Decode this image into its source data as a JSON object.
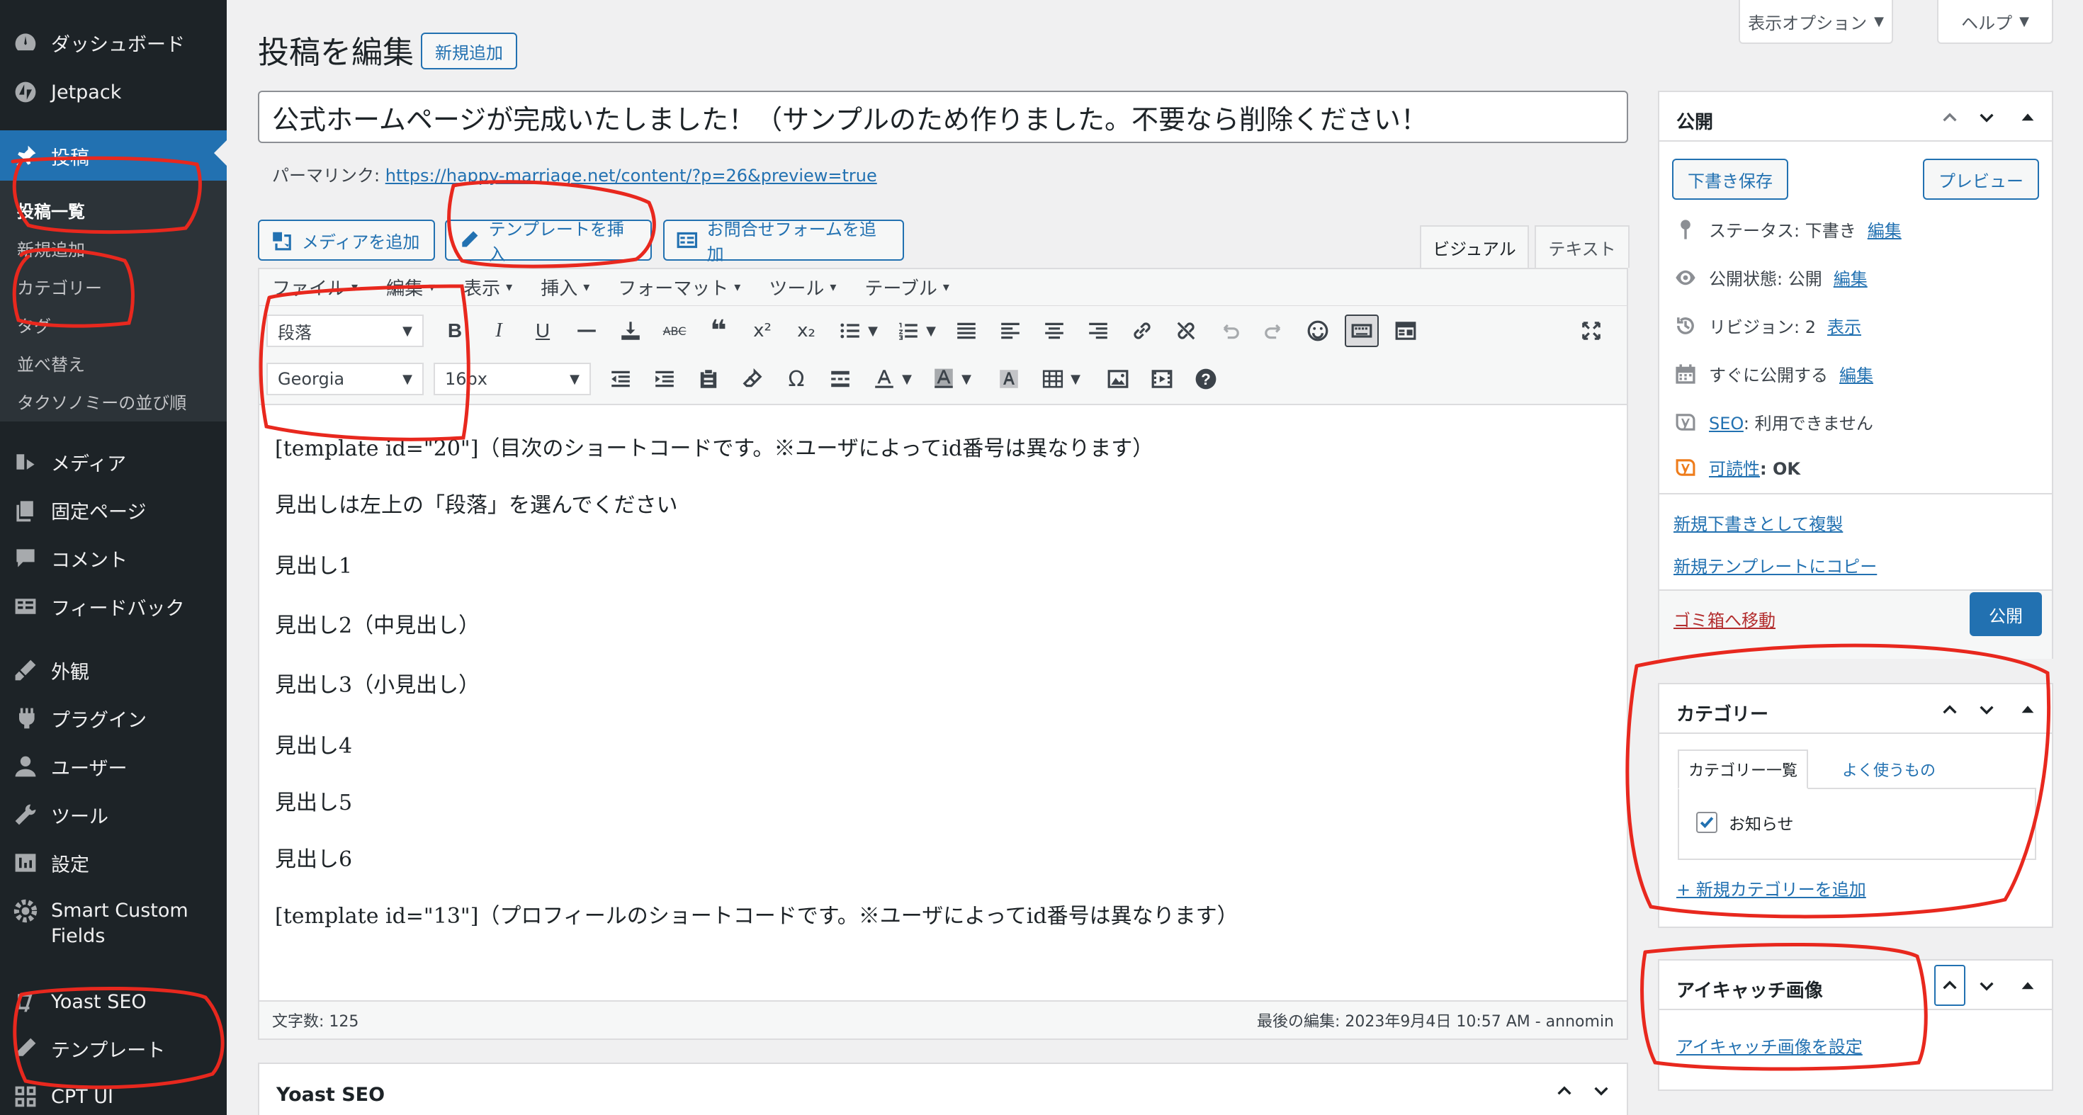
{
  "sidebar": {
    "items": [
      {
        "label": "ダッシュボード",
        "icon": "dashboard-icon"
      },
      {
        "label": "Jetpack",
        "icon": "jetpack-icon"
      },
      {
        "label": "投稿",
        "icon": "pin-icon"
      },
      {
        "label": "メディア",
        "icon": "media-icon"
      },
      {
        "label": "固定ページ",
        "icon": "page-icon"
      },
      {
        "label": "コメント",
        "icon": "comment-icon"
      },
      {
        "label": "フィードバック",
        "icon": "feedback-icon"
      },
      {
        "label": "外観",
        "icon": "appearance-icon"
      },
      {
        "label": "プラグイン",
        "icon": "plugin-icon"
      },
      {
        "label": "ユーザー",
        "icon": "user-icon"
      },
      {
        "label": "ツール",
        "icon": "tool-icon"
      },
      {
        "label": "設定",
        "icon": "settings-icon"
      },
      {
        "label": "Smart Custom Fields",
        "icon": "gear-icon"
      },
      {
        "label": "Yoast SEO",
        "icon": "yoast-icon"
      },
      {
        "label": "テンプレート",
        "icon": "pencil-icon"
      },
      {
        "label": "CPT UI",
        "icon": "cpt-icon"
      }
    ],
    "subitems": [
      "投稿一覧",
      "新規追加",
      "カテゴリー",
      "タグ",
      "並べ替え",
      "タクソノミーの並び順"
    ]
  },
  "screen_options": {
    "label": "表示オプション",
    "help": "ヘルプ"
  },
  "page": {
    "title": "投稿を編集",
    "add_new": "新規追加"
  },
  "post": {
    "title": "公式ホームページが完成いたしました！（サンプルのため作りました。不要なら削除ください！",
    "permalink_label": "パーマリンク:",
    "permalink_url": "https://happy-marriage.net/content/?p=26&preview=true"
  },
  "media_buttons": {
    "add_media": "メディアを追加",
    "insert_template": "テンプレートを挿入",
    "add_form": "お問合せフォームを追加"
  },
  "editor": {
    "tab_visual": "ビジュアル",
    "tab_text": "テキスト",
    "menus": [
      "ファイル",
      "編集",
      "表示",
      "挿入",
      "フォーマット",
      "ツール",
      "テーブル"
    ],
    "format_select": "段落",
    "font_select": "Georgia",
    "size_select": "16px",
    "paragraphs": [
      "[template id=\"20\"]（目次のショートコードです。※ユーザによってid番号は異なります）",
      "見出しは左上の「段落」を選んでください",
      "見出し1",
      "見出し2（中見出し）",
      "見出し3（小見出し）",
      "見出し4",
      "見出し5",
      "見出し6",
      "[template id=\"13\"]（プロフィールのショートコードです。※ユーザによってid番号は異なります）"
    ],
    "word_count": "文字数: 125",
    "last_edit": "最後の編集: 2023年9月4日 10:57 AM - annomin"
  },
  "yoast_box": {
    "title": "Yoast SEO"
  },
  "publish_box": {
    "title": "公開",
    "save_draft": "下書き保存",
    "preview": "プレビュー",
    "status_label": "ステータス: 下書き",
    "visibility_label": "公開状態: 公開",
    "revisions_label": "リビジョン: 2",
    "schedule_label": "すぐに公開する",
    "edit": "編集",
    "show": "表示",
    "seo_link": "SEO",
    "seo_text": ": 利用できません",
    "readability_link": "可読性",
    "readability_text": ": OK",
    "duplicate_draft": "新規下書きとして複製",
    "copy_template": "新規テンプレートにコピー",
    "trash": "ゴミ箱へ移動",
    "publish": "公開"
  },
  "category_box": {
    "title": "カテゴリー",
    "tab_all": "カテゴリー一覧",
    "tab_popular": "よく使うもの",
    "categories": [
      {
        "label": "お知らせ",
        "checked": true
      }
    ],
    "add_new": "+ 新規カテゴリーを追加"
  },
  "thumbnail_box": {
    "title": "アイキャッチ画像",
    "set": "アイキャッチ画像を設定"
  },
  "colors": {
    "accent": "#2271b1",
    "sidebar": "#1d2327",
    "annotation": "#e8281e"
  }
}
